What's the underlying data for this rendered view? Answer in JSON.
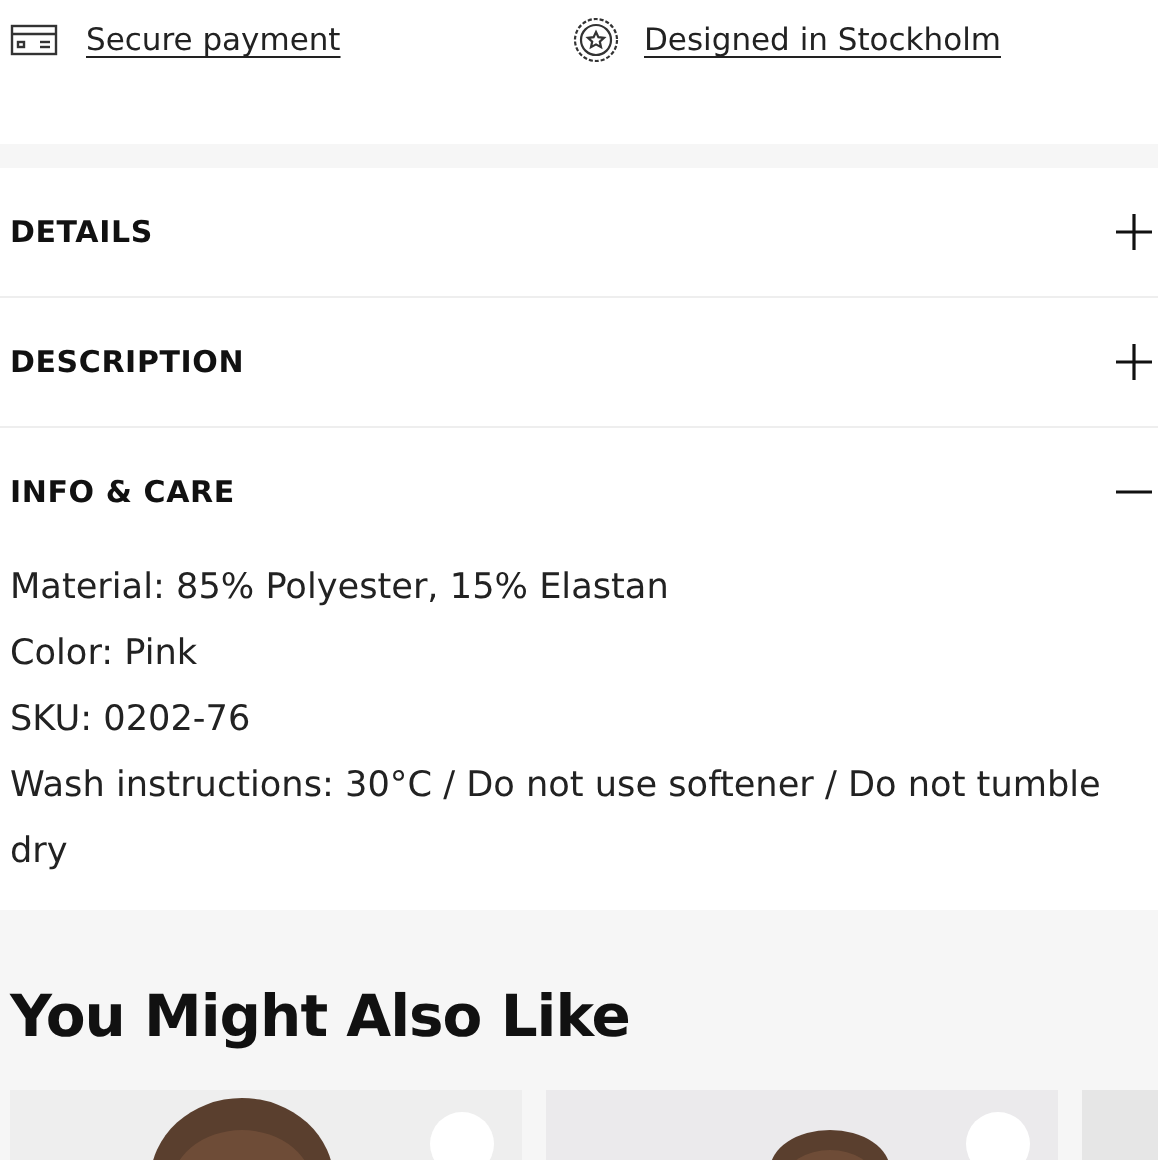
{
  "trust_links": [
    {
      "kind": "card",
      "label": "Secure payment"
    },
    {
      "kind": "badge",
      "label": "Designed in Stockholm"
    }
  ],
  "accordion": [
    {
      "title": "DETAILS",
      "expanded": false
    },
    {
      "title": "DESCRIPTION",
      "expanded": false
    },
    {
      "title": "INFO & CARE",
      "expanded": true,
      "lines": [
        "Material: 85% Polyester, 15% Elastan",
        "Color: Pink",
        "SKU: 0202-76",
        "Wash instructions: 30°C / Do not use softener / Do not tumble dry"
      ]
    }
  ],
  "recommendations": {
    "heading": "You Might Also Like"
  }
}
